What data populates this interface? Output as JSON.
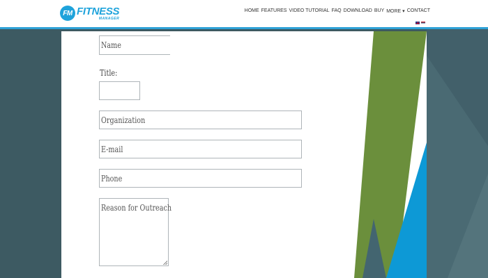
{
  "header": {
    "logo": {
      "badge": "FM",
      "title": "FITNESS",
      "subtitle": "MANAGER"
    },
    "nav": [
      "HOME",
      "FEATURES",
      "VIDEO TUTORIAL",
      "FAQ",
      "DOWNLOAD",
      "BUY",
      "MORE ▾",
      "CONTACT"
    ],
    "languages": [
      "english-flag",
      "serbian-flag"
    ]
  },
  "form": {
    "name_placeholder": "Name",
    "title_label": "Title:",
    "organization_placeholder": "Organization",
    "email_placeholder": "E-mail",
    "phone_placeholder": "Phone",
    "reason_placeholder": "Reason for Outreach"
  },
  "colors": {
    "brand": "#1fa3db",
    "header_border": "#2ea1d6",
    "green_stripe": "#6b8f3c",
    "blue_stripe": "#0d99d6",
    "page_bg": "#3d5a62"
  }
}
